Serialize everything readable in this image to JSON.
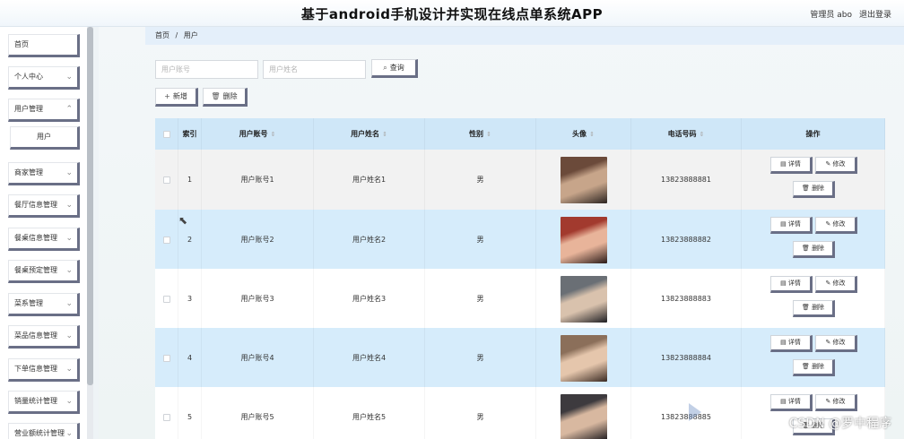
{
  "header": {
    "title": "基于android手机设计并实现在线点单系统APP",
    "user": "管理员 abo",
    "logout": "退出登录"
  },
  "sidebar": {
    "items": [
      {
        "label": "首页",
        "chevron": false
      },
      {
        "label": "个人中心",
        "chevron": true
      },
      {
        "label": "用户管理",
        "chevron": true
      },
      {
        "label": "用户",
        "chevron": false,
        "sub": true
      },
      {
        "label": "商家管理",
        "chevron": true
      },
      {
        "label": "餐厅信息管理",
        "chevron": true
      },
      {
        "label": "餐桌信息管理",
        "chevron": true
      },
      {
        "label": "餐桌预定管理",
        "chevron": true
      },
      {
        "label": "菜系管理",
        "chevron": true
      },
      {
        "label": "菜品信息管理",
        "chevron": true
      },
      {
        "label": "下单信息管理",
        "chevron": true
      },
      {
        "label": "销量统计管理",
        "chevron": true
      },
      {
        "label": "营业额统计管理",
        "chevron": true
      }
    ]
  },
  "breadcrumb": {
    "home": "首页",
    "sep": "/",
    "current": "用户"
  },
  "search": {
    "account_placeholder": "用户账号",
    "name_placeholder": "用户姓名",
    "query": "查询"
  },
  "actions": {
    "add": "新增",
    "delete": "删除"
  },
  "table": {
    "headers": {
      "index": "索引",
      "account": "用户账号",
      "name": "用户姓名",
      "gender": "性别",
      "avatar": "头像",
      "phone": "电话号码",
      "ops": "操作"
    },
    "rows": [
      {
        "index": "1",
        "account": "用户账号1",
        "name": "用户姓名1",
        "gender": "男",
        "phone": "13823888881"
      },
      {
        "index": "2",
        "account": "用户账号2",
        "name": "用户姓名2",
        "gender": "男",
        "phone": "13823888882"
      },
      {
        "index": "3",
        "account": "用户账号3",
        "name": "用户姓名3",
        "gender": "男",
        "phone": "13823888883"
      },
      {
        "index": "4",
        "account": "用户账号4",
        "name": "用户姓名4",
        "gender": "男",
        "phone": "13823888884"
      },
      {
        "index": "5",
        "account": "用户账号5",
        "name": "用户姓名5",
        "gender": "男",
        "phone": "13823888885"
      }
    ],
    "op_labels": {
      "detail": "详情",
      "edit": "修改",
      "delete": "删除"
    }
  },
  "watermark": "CSDN @罗中程序"
}
